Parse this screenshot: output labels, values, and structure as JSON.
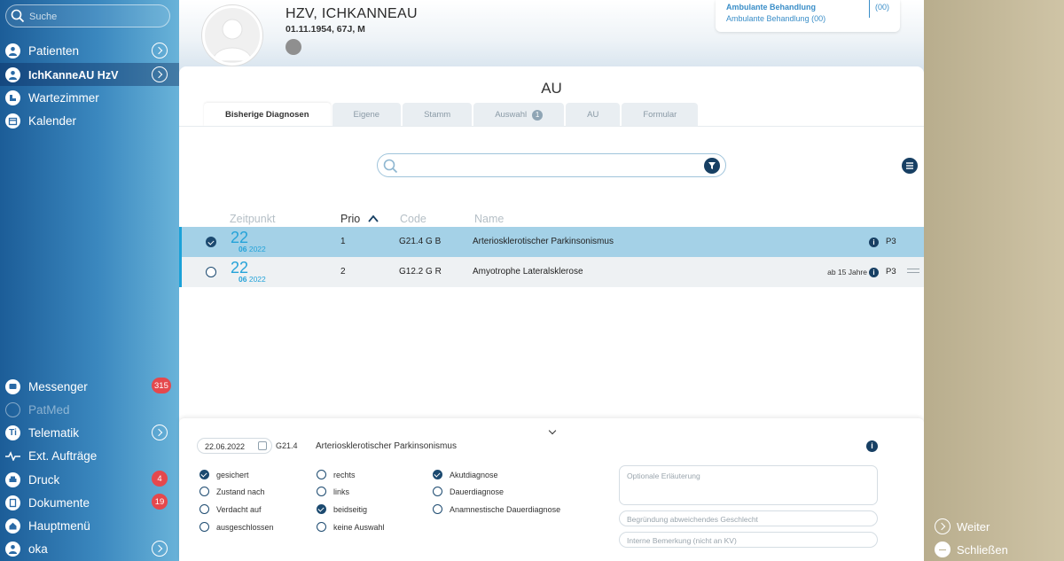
{
  "sidebar": {
    "search_placeholder": "Suche",
    "items_top": [
      {
        "label": "Patienten"
      },
      {
        "label": "IchKanneAU HzV"
      },
      {
        "label": "Wartezimmer"
      },
      {
        "label": "Kalender"
      }
    ],
    "items_bottom": [
      {
        "label": "Messenger",
        "badge": "315"
      },
      {
        "label": "PatMed"
      },
      {
        "label": "Telematik",
        "icon_text": "Ti"
      },
      {
        "label": "Ext. Aufträge"
      },
      {
        "label": "Druck",
        "badge": "4"
      },
      {
        "label": "Dokumente",
        "badge": "19"
      },
      {
        "label": "Hauptmenü"
      },
      {
        "label": "oka"
      }
    ]
  },
  "patient": {
    "name": "HZV,  ICHKANNEAU",
    "dob_line": "01.11.1954, 67J, M"
  },
  "behandlung": {
    "line1": "Ambulante Behandlung",
    "line2": "Ambulante Behandlung (00)",
    "count": "(00)"
  },
  "main": {
    "title": "AU",
    "tabs": [
      {
        "label": "Bisherige Diagnosen"
      },
      {
        "label": "Eigene"
      },
      {
        "label": "Stamm"
      },
      {
        "label": "Auswahl",
        "badge": "1"
      },
      {
        "label": "AU"
      },
      {
        "label": "Formular"
      }
    ],
    "columns": {
      "zeitpunkt": "Zeitpunkt",
      "prio": "Prio",
      "code": "Code",
      "name": "Name"
    },
    "rows": [
      {
        "day": "22",
        "month": "06",
        "year": "2022",
        "prio": "1",
        "code": "G21.4 G B",
        "name": "Arteriosklerotischer Parkinsonismus",
        "age": "",
        "p": "P3"
      },
      {
        "day": "22",
        "month": "06",
        "year": "2022",
        "prio": "2",
        "code": "G12.2 G R",
        "name": "Amyotrophe Lateralsklerose",
        "age": "ab 15 Jahre",
        "p": "P3"
      }
    ]
  },
  "detail": {
    "date": "22.06.2022",
    "code": "G21.4",
    "name": "Arteriosklerotischer Parkinsonismus",
    "col1": [
      "gesichert",
      "Zustand nach",
      "Verdacht auf",
      "ausgeschlossen"
    ],
    "col2": [
      "rechts",
      "links",
      "beidseitig",
      "keine Auswahl"
    ],
    "col3": [
      "Akutdiagnose",
      "Dauerdiagnose",
      "Anamnestische Dauerdiagnose"
    ],
    "erlaeuterung_placeholder": "Optionale Erläuterung",
    "begruendung_placeholder": "Begründung abweichendes Geschlecht",
    "bemerkung_placeholder": "Interne Bemerkung (nicht an KV)"
  },
  "right": {
    "weiter": "Weiter",
    "schliessen": "Schließen"
  }
}
